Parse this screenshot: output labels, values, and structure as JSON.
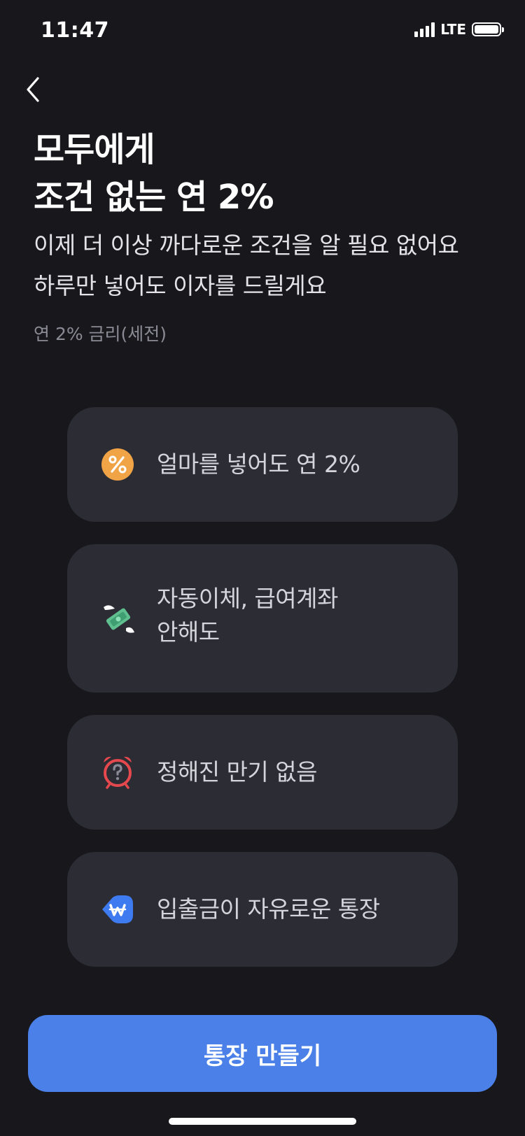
{
  "status_bar": {
    "time": "11:47",
    "network": "LTE"
  },
  "header": {
    "back_icon": "chevron-left-icon"
  },
  "title": {
    "line1": "모두에게",
    "line2": "조건 없는 연 2%"
  },
  "subtitle": {
    "line1": "이제 더 이상 까다로운 조건을 알 필요 없어요",
    "line2": "하루만 넣어도 이자를 드릴게요"
  },
  "rate_note": "연 2% 금리(세전)",
  "features": [
    {
      "icon": "percent-icon",
      "line1": "얼마를 넣어도 연 2%",
      "line2": ""
    },
    {
      "icon": "flying-money-icon",
      "line1": "자동이체, 급여계좌",
      "line2": "안해도"
    },
    {
      "icon": "alarm-clock-question-icon",
      "line1": "정해진 만기 없음",
      "line2": ""
    },
    {
      "icon": "won-tag-icon",
      "line1": "입출금이 자유로운 통장",
      "line2": ""
    }
  ],
  "cta": {
    "label": "통장 만들기"
  },
  "colors": {
    "background": "#17171c",
    "card": "#2c2c35",
    "accent": "#4a80e8",
    "percent_icon": "#f1a446",
    "alarm_icon": "#e5484d",
    "won_icon": "#3f7bf0"
  }
}
